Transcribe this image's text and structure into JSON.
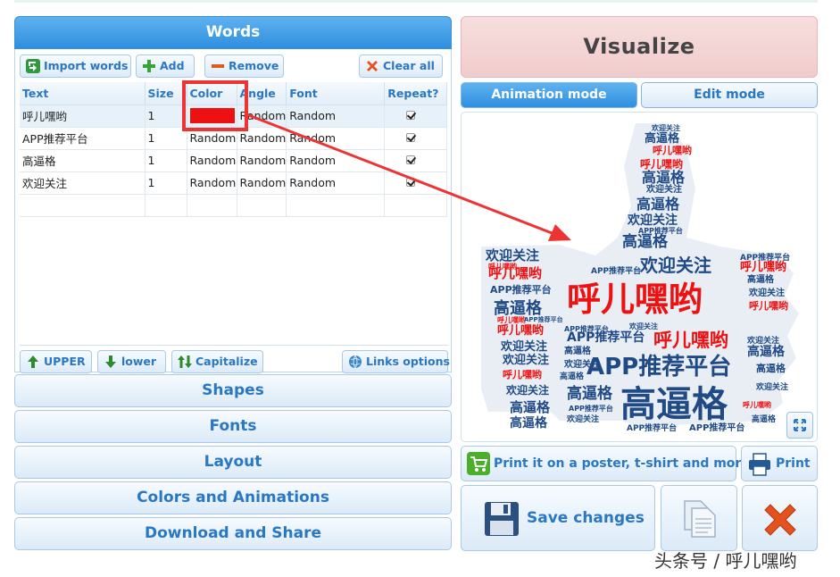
{
  "words_panel": {
    "title": "Words",
    "toolbar": {
      "import_label": "Import words",
      "add_label": "Add",
      "remove_label": "Remove",
      "clear_label": "Clear all"
    },
    "columns": [
      "Text",
      "Size",
      "Color",
      "Angle",
      "Font",
      "Repeat?"
    ],
    "rows": [
      {
        "text": "呼儿嘿哟",
        "size": "1",
        "color": "#ee1111",
        "angle": "Random",
        "font": "Random",
        "repeat": true
      },
      {
        "text": "APP推荐平台",
        "size": "1",
        "color": "Random",
        "angle": "Random",
        "font": "Random",
        "repeat": true
      },
      {
        "text": "高逼格",
        "size": "1",
        "color": "Random",
        "angle": "Random",
        "font": "Random",
        "repeat": true
      },
      {
        "text": "欢迎关注",
        "size": "1",
        "color": "Random",
        "angle": "Random",
        "font": "Random",
        "repeat": true
      }
    ],
    "case_buttons": {
      "upper_label": "UPPER",
      "lower_label": "lower",
      "capitalize_label": "Capitalize",
      "links_label": "Links options"
    }
  },
  "sections": {
    "shapes": "Shapes",
    "fonts": "Fonts",
    "layout": "Layout",
    "colors": "Colors and Animations",
    "download": "Download and Share"
  },
  "right_panel": {
    "visualize_label": "Visualize",
    "animation_mode_label": "Animation mode",
    "edit_mode_label": "Edit mode",
    "poster_label": "Print it on a poster, t-shirt and more!",
    "print_label": "Print",
    "save_label": "Save changes"
  },
  "wordcloud": {
    "words": [
      {
        "text": "呼儿嘿哟",
        "color": "#ee1111"
      },
      {
        "text": "APP推荐平台",
        "color": "#1f4a86"
      },
      {
        "text": "高逼格",
        "color": "#1f4a86"
      },
      {
        "text": "欢迎关注",
        "color": "#1f4a86"
      }
    ]
  },
  "watermark": "头条号 / 呼儿嘿哟",
  "colors": {
    "accent_blue": "#2e8fe0",
    "annotation_red": "#ee3333"
  }
}
